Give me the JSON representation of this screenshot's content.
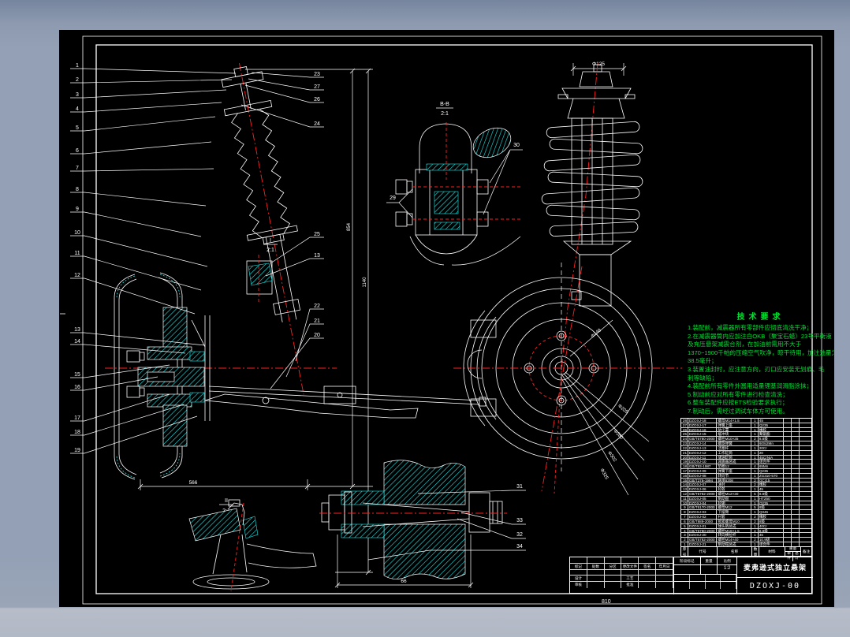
{
  "colors": {
    "background": "#93a0b5",
    "sheet": "#000000",
    "line": "#ffffff",
    "hatch": "#1fe8e8",
    "centerline": "#ff2020",
    "annotation_green": "#00e033"
  },
  "drawing": {
    "number": "DZOXJ-00",
    "title": "麦弗逊式独立悬架",
    "sheet_size_note": "810"
  },
  "balloons": {
    "left": [
      "1",
      "2",
      "3",
      "4",
      "5",
      "6",
      "7",
      "8",
      "9",
      "10",
      "11",
      "12",
      "13",
      "14",
      "15",
      "16",
      "17",
      "18",
      "19"
    ],
    "top_right": [
      "23",
      "27",
      "26",
      "24"
    ],
    "mid_right": [
      "25",
      "13"
    ],
    "lower_right": [
      "22",
      "21",
      "20"
    ],
    "bb": [
      "29",
      "30"
    ],
    "section": [
      "31",
      "33",
      "32",
      "34"
    ]
  },
  "details": {
    "bb_label": "B-B",
    "bb_scale": "2:1",
    "d1_label": "I",
    "d1_scale": "2:1",
    "d2_label": "II",
    "d2_scale": "2:1"
  },
  "dimensions": {
    "overall_height": "854",
    "total_height": "1140",
    "track_width": "566",
    "pin_length": "66",
    "top_diameter": "Φ125",
    "disc_diameters": [
      "Φ148",
      "Φ205",
      "Φ280",
      "Φ302",
      "Φ325"
    ]
  },
  "tech": {
    "title": "技术要求",
    "lines": [
      "1.装配前，减震器所有零部件应彻底清洗干净；",
      "2.在减震器筒内应加注白OKB（聚宝石蜡）23号平衡液",
      "及充压悬架减震合剂，在加油前需用不大于",
      "1370~1900千帕的压缩空气吹净，晾干待用，加注油量为",
      "38.5毫升；",
      "3.装置油封时，应注意方向，刃口应安装无划痕、毛",
      "刺等缺陷；",
      "4.装配前所有零件外圆用适量锂基润滑脂涂抹；",
      "5.制动前应对所有零件进行检查清洗；",
      "6.整车装配件应按ETS检验要求执行；",
      "7.制动后，需经过调试车体方可使用。"
    ]
  },
  "bom": {
    "headers": {
      "no": "序号",
      "code": "代号",
      "name": "名称",
      "qty": "数量",
      "mat": "材料",
      "weight": "重量",
      "unit": "单件",
      "total": "总计",
      "remark": "备注"
    },
    "rows": [
      {
        "no": "28",
        "code": "DZOXJ-18",
        "name": "螺母M14×1.5",
        "qty": "1",
        "mat": "45",
        "rem": ""
      },
      {
        "no": "27",
        "code": "DZOXJ-17",
        "name": "弹簧上座",
        "qty": "1",
        "mat": "Q235",
        "rem": ""
      },
      {
        "no": "26",
        "code": "DZOXJ-16",
        "name": "防尘罩",
        "qty": "1",
        "mat": "橡胶",
        "rem": ""
      },
      {
        "no": "25",
        "code": "DZOXJ-15",
        "name": "缓冲块",
        "qty": "1",
        "mat": "聚氨酯",
        "rem": ""
      },
      {
        "no": "24",
        "code": "GB/T5780-2000",
        "name": "螺栓M10×35",
        "qty": "2",
        "mat": "8.8级",
        "rem": ""
      },
      {
        "no": "23",
        "code": "DZOXJ-14",
        "name": "螺旋弹簧",
        "qty": "1",
        "mat": "60Si2Mn",
        "rem": ""
      },
      {
        "no": "22",
        "code": "DZOXJ-13",
        "name": "活塞杆",
        "qty": "1",
        "mat": "20Cr",
        "rem": ""
      },
      {
        "no": "21",
        "code": "DZOXJ-12",
        "name": "工作缸筒",
        "qty": "1",
        "mat": "20",
        "rem": ""
      },
      {
        "no": "20",
        "code": "DZOXJ-11",
        "name": "储油缸筒",
        "qty": "1",
        "mat": "45CrNiA",
        "rem": ""
      },
      {
        "no": "19",
        "code": "DZOXJ-10",
        "name": "减震器总成",
        "qty": "1",
        "mat": "组合件",
        "rem": ""
      },
      {
        "no": "18",
        "code": "GB/T93-1987",
        "name": "垫圈12",
        "qty": "4",
        "mat": "65Mn",
        "rem": ""
      },
      {
        "no": "17",
        "code": "DZOXJ-09",
        "name": "弹簧下座",
        "qty": "1",
        "mat": "Q235",
        "rem": ""
      },
      {
        "no": "16",
        "code": "DZOXJ-08",
        "name": "转向节",
        "qty": "1",
        "mat": "ZG310-570",
        "rem": ""
      },
      {
        "no": "15",
        "code": "GB/T276-1994",
        "name": "轴承6208",
        "qty": "2",
        "mat": "GCr15",
        "rem": ""
      },
      {
        "no": "14",
        "code": "DZOXJ-07",
        "name": "油封",
        "qty": "2",
        "mat": "橡胶",
        "rem": ""
      },
      {
        "no": "13",
        "code": "DZOXJ-06",
        "name": "轮毂",
        "qty": "1",
        "mat": "45",
        "rem": ""
      },
      {
        "no": "12",
        "code": "GB/T5782-2000",
        "name": "螺栓M12×30",
        "qty": "5",
        "mat": "8.8级",
        "rem": ""
      },
      {
        "no": "11",
        "code": "DZOXJ-05",
        "name": "制动盘",
        "qty": "1",
        "mat": "HT250",
        "rem": ""
      },
      {
        "no": "10",
        "code": "DZOXJ-04",
        "name": "轮辋",
        "qty": "1",
        "mat": "Q235",
        "rem": ""
      },
      {
        "no": "9",
        "code": "GB/T6170-2000",
        "name": "螺母M12",
        "qty": "5",
        "mat": "8级",
        "rem": ""
      },
      {
        "no": "8",
        "code": "DZOXJ-03",
        "name": "下摆臂",
        "qty": "1",
        "mat": "Q345",
        "rem": ""
      },
      {
        "no": "7",
        "code": "DZOXJ-02",
        "name": "衬套",
        "qty": "2",
        "mat": "橡胶",
        "rem": ""
      },
      {
        "no": "6",
        "code": "GB/T889-2000",
        "name": "锁紧螺母M10",
        "qty": "2",
        "mat": "8级",
        "rem": ""
      },
      {
        "no": "5",
        "code": "DZOXJ-01",
        "name": "球头销总成",
        "qty": "1",
        "mat": "40Cr",
        "rem": ""
      },
      {
        "no": "4",
        "code": "GB/T5780-2000",
        "name": "螺栓M16×1.5",
        "qty": "4",
        "mat": "8.8级",
        "rem": ""
      },
      {
        "no": "3",
        "code": "DZOXJ-20",
        "name": "转向横拉杆",
        "qty": "1",
        "mat": "45",
        "rem": ""
      },
      {
        "no": "2",
        "code": "GB/T5782-2000",
        "name": "螺栓M14×40",
        "qty": "2",
        "mat": "10.9级",
        "rem": ""
      },
      {
        "no": "1",
        "code": "DZOXJ-21",
        "name": "制动钳总成",
        "qty": "1",
        "mat": "组合件",
        "rem": ""
      }
    ]
  },
  "title_block": {
    "rev_headers": [
      "标记",
      "处数",
      "分区",
      "更改文件号",
      "签名",
      "年月日"
    ],
    "sign_row1": [
      "设计",
      "",
      "",
      "工艺",
      "",
      ""
    ],
    "sign_row2": [
      "审核",
      "",
      "",
      "批准",
      "",
      ""
    ],
    "stage_label": "阶段标记",
    "weight_label": "重量",
    "scale_label": "比例",
    "scale": "1:2",
    "title": "麦弗逊式独立悬架",
    "number": "DZOXJ-00"
  }
}
